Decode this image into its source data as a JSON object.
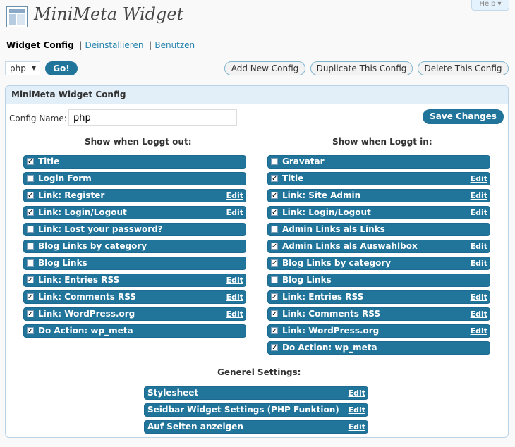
{
  "header": {
    "help_label": "Help ▾",
    "title": "MiniMeta Widget",
    "icon": "widget-settings-icon"
  },
  "subnav": {
    "current": "Widget Config",
    "sep1": "|",
    "uninstall": "Deinstallieren",
    "sep2": "|",
    "usage": "Benutzen"
  },
  "controls": {
    "config_select_value": "php",
    "go_label": "Go!",
    "add_label": "Add New Config",
    "duplicate_label": "Duplicate This Config",
    "delete_label": "Delete This Config"
  },
  "panel": {
    "title": "MiniMeta Widget Config",
    "config_name_label": "Config Name:",
    "config_name_value": "php",
    "save_label": "Save Changes"
  },
  "logged_out": {
    "heading": "Show when Loggt out:",
    "items": [
      {
        "label": "Title",
        "checked": true,
        "edit": ""
      },
      {
        "label": "Login Form",
        "checked": false,
        "edit": ""
      },
      {
        "label": "Link: Register",
        "checked": true,
        "edit": "Edit"
      },
      {
        "label": "Link: Login/Logout",
        "checked": true,
        "edit": "Edit"
      },
      {
        "label": "Link: Lost your password?",
        "checked": false,
        "edit": ""
      },
      {
        "label": "Blog Links by category",
        "checked": false,
        "edit": ""
      },
      {
        "label": "Blog Links",
        "checked": false,
        "edit": ""
      },
      {
        "label": "Link: Entries RSS",
        "checked": true,
        "edit": "Edit"
      },
      {
        "label": "Link: Comments RSS",
        "checked": true,
        "edit": "Edit"
      },
      {
        "label": "Link: WordPress.org",
        "checked": true,
        "edit": "Edit"
      },
      {
        "label": "Do Action: wp_meta",
        "checked": true,
        "edit": ""
      }
    ]
  },
  "logged_in": {
    "heading": "Show when Loggt in:",
    "items": [
      {
        "label": "Gravatar",
        "checked": false,
        "edit": ""
      },
      {
        "label": "Title",
        "checked": true,
        "edit": "Edit"
      },
      {
        "label": "Link: Site Admin",
        "checked": true,
        "edit": "Edit"
      },
      {
        "label": "Link: Login/Logout",
        "checked": true,
        "edit": "Edit"
      },
      {
        "label": "Admin Links als Links",
        "checked": false,
        "edit": ""
      },
      {
        "label": "Admin Links als Auswahlbox",
        "checked": true,
        "edit": "Edit"
      },
      {
        "label": "Blog Links by category",
        "checked": true,
        "edit": "Edit"
      },
      {
        "label": "Blog Links",
        "checked": false,
        "edit": ""
      },
      {
        "label": "Link: Entries RSS",
        "checked": true,
        "edit": "Edit"
      },
      {
        "label": "Link: Comments RSS",
        "checked": true,
        "edit": "Edit"
      },
      {
        "label": "Link: WordPress.org",
        "checked": true,
        "edit": "Edit"
      },
      {
        "label": "Do Action: wp_meta",
        "checked": true,
        "edit": ""
      }
    ]
  },
  "general": {
    "heading": "Generel Settings:",
    "items": [
      {
        "label": "Stylesheet",
        "edit": "Edit"
      },
      {
        "label": "Seidbar Widget Settings (PHP Funktion)",
        "edit": "Edit"
      },
      {
        "label": "Auf Seiten anzeigen",
        "edit": "Edit"
      }
    ]
  }
}
